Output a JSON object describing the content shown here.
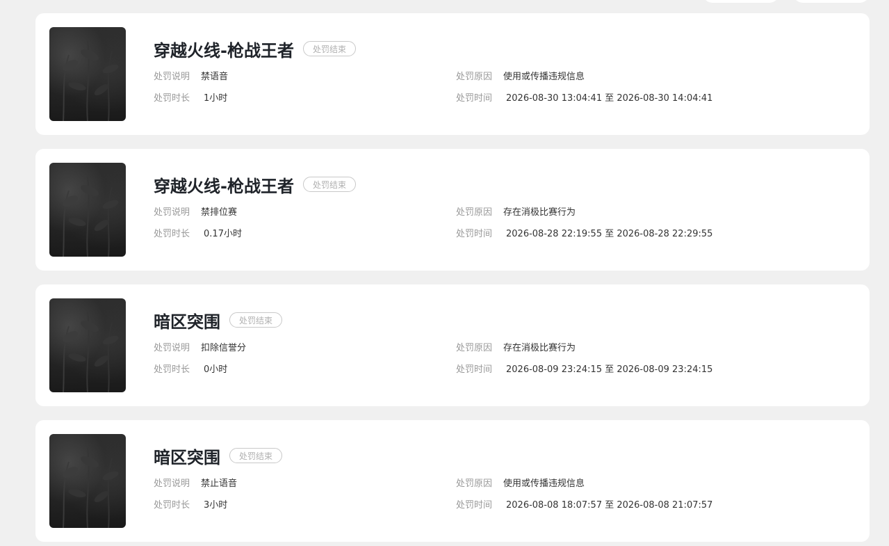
{
  "labels": {
    "desc": "处罚说明",
    "reason": "处罚原因",
    "duration": "处罚时长",
    "time": "处罚时间"
  },
  "records": [
    {
      "game": "穿越火线-枪战王者",
      "status": "处罚结束",
      "desc": "禁语音",
      "reason": "使用或传播违规信息",
      "duration": "1小时",
      "time": "2026-08-30 13:04:41 至 2026-08-30 14:04:41"
    },
    {
      "game": "穿越火线-枪战王者",
      "status": "处罚结束",
      "desc": "禁排位赛",
      "reason": "存在消极比赛行为",
      "duration": "0.17小时",
      "time": "2026-08-28 22:19:55 至 2026-08-28 22:29:55"
    },
    {
      "game": "暗区突围",
      "status": "处罚结束",
      "desc": "扣除信誉分",
      "reason": "存在消极比赛行为",
      "duration": "0小时",
      "time": "2026-08-09 23:24:15 至 2026-08-09 23:24:15"
    },
    {
      "game": "暗区突围",
      "status": "处罚结束",
      "desc": "禁止语音",
      "reason": "使用或传播违规信息",
      "duration": "3小时",
      "time": "2026-08-08 18:07:57 至 2026-08-08 21:07:57"
    }
  ]
}
